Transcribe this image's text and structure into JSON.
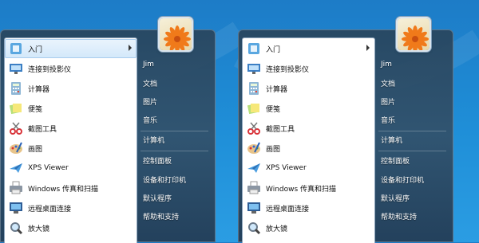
{
  "menus": [
    {
      "programs": [
        {
          "label": "入门",
          "icon": "getting-started-icon",
          "arrow": true
        },
        {
          "label": "连接到投影仪",
          "icon": "projector-icon"
        },
        {
          "label": "计算器",
          "icon": "calculator-icon"
        },
        {
          "label": "便笺",
          "icon": "sticky-notes-icon"
        },
        {
          "label": "截图工具",
          "icon": "scissors-icon"
        },
        {
          "label": "画图",
          "icon": "paint-palette-icon"
        },
        {
          "label": "XPS Viewer",
          "icon": "xps-viewer-icon"
        },
        {
          "label": "Windows 传真和扫描",
          "icon": "fax-printer-icon"
        },
        {
          "label": "远程桌面连接",
          "icon": "remote-desktop-icon"
        },
        {
          "label": "放大镜",
          "icon": "magnifier-icon"
        }
      ],
      "links": [
        "Jim",
        "文档",
        "图片",
        "音乐",
        "计算机",
        "控制面板",
        "设备和打印机",
        "默认程序",
        "帮助和支持"
      ]
    },
    {
      "programs": [
        {
          "label": "入门",
          "icon": "getting-started-icon",
          "arrow": true
        },
        {
          "label": "连接到投影仪",
          "icon": "projector-icon"
        },
        {
          "label": "计算器",
          "icon": "calculator-icon"
        },
        {
          "label": "便笺",
          "icon": "sticky-notes-icon"
        },
        {
          "label": "截图工具",
          "icon": "scissors-icon"
        },
        {
          "label": "画图",
          "icon": "paint-palette-icon"
        },
        {
          "label": "XPS Viewer",
          "icon": "xps-viewer-icon"
        },
        {
          "label": "Windows 传真和扫描",
          "icon": "fax-printer-icon"
        },
        {
          "label": "远程桌面连接",
          "icon": "remote-desktop-icon"
        },
        {
          "label": "放大镜",
          "icon": "magnifier-icon"
        }
      ],
      "links": [
        "Jim",
        "文档",
        "图片",
        "音乐",
        "计算机",
        "控制面板",
        "设备和打印机",
        "默认程序",
        "帮助和支持"
      ]
    }
  ],
  "colors": {
    "desktop": "#1f8fd8",
    "menu_glass": "#2c4f6c",
    "link_text": "#ffffff"
  }
}
